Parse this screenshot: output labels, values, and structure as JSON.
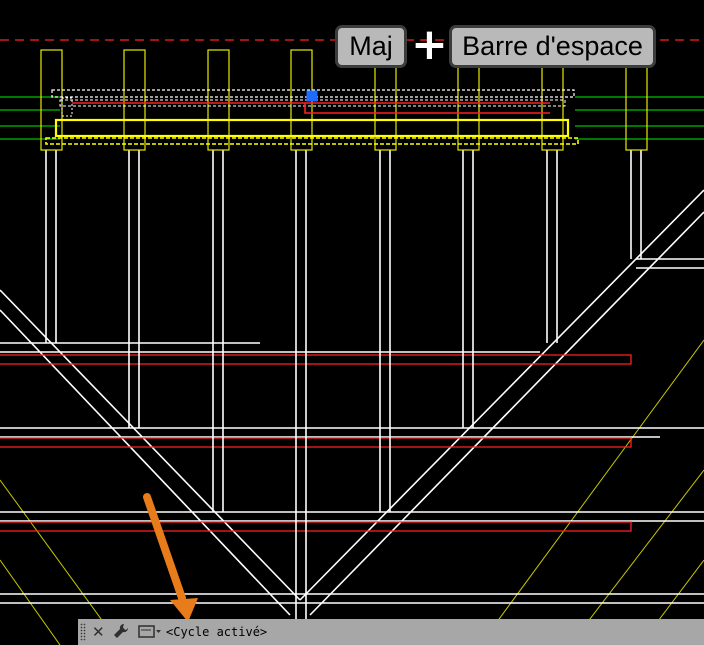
{
  "shortcut": {
    "key1": "Maj",
    "plus": "+",
    "key2": "Barre d'espace"
  },
  "command_line": {
    "prompt_text": "<Cycle activé>",
    "close_icon": "close-icon",
    "customize_icon": "wrench-icon",
    "prompt_icon": "command-prompt-icon"
  },
  "colors": {
    "background": "#000000",
    "structure_lines": "#ffffff",
    "selected_lines": "#ff0000",
    "highlight": "#ffff00",
    "guide_lines": "#00c000",
    "hatch_lines": "#c8c800",
    "grip": "#1e5cff",
    "annotation_arrow": "#e87b1a",
    "command_bar": "#a7a7a7"
  }
}
